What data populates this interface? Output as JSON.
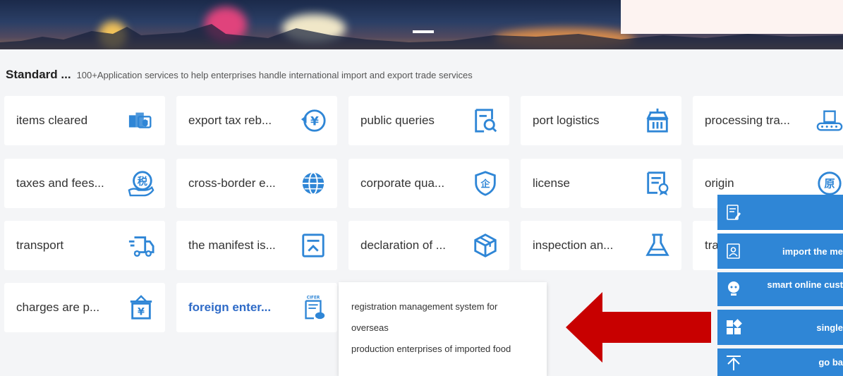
{
  "heading": {
    "title": "Standard ...",
    "subtitle": "100+Application services to help enterprises handle international import and export trade services"
  },
  "cards": [
    {
      "label": "items cleared",
      "icon": "customs-clearance-icon"
    },
    {
      "label": "export tax reb...",
      "icon": "yen-tax-rebate-icon"
    },
    {
      "label": "public queries",
      "icon": "document-search-icon"
    },
    {
      "label": "port logistics",
      "icon": "port-crane-icon"
    },
    {
      "label": "processing tra...",
      "icon": "conveyor-box-icon"
    },
    {
      "label": "taxes and fees...",
      "icon": "tax-hand-icon"
    },
    {
      "label": "cross-border e...",
      "icon": "globe-icon"
    },
    {
      "label": "corporate qua...",
      "icon": "shield-enterprise-icon"
    },
    {
      "label": "license",
      "icon": "certificate-icon"
    },
    {
      "label": "origin",
      "icon": "origin-badge-icon"
    },
    {
      "label": "transport",
      "icon": "truck-icon"
    },
    {
      "label": "the manifest is...",
      "icon": "manifest-upload-icon"
    },
    {
      "label": "declaration of ...",
      "icon": "package-box-icon"
    },
    {
      "label": "inspection an...",
      "icon": "flask-icon"
    },
    {
      "label": "tra",
      "icon": "hidden-icon"
    },
    {
      "label": "charges are p...",
      "icon": "yen-box-icon"
    },
    {
      "label": "foreign enter...",
      "icon": "cifer-document-icon"
    }
  ],
  "icon_glyphs": {
    "tax": "税",
    "enterprise": "企",
    "origin": "原",
    "yen": "¥",
    "cifer": "CIFER"
  },
  "tooltip": {
    "line1": "registration management system for overseas",
    "line2": "production enterprises of imported food"
  },
  "float_panel": [
    {
      "label": "",
      "icon": "edit-document-icon"
    },
    {
      "label": "import the me",
      "icon": "contact-card-icon"
    },
    {
      "label": "smart online cust",
      "icon": "robot-assistant-icon"
    },
    {
      "label": "single",
      "icon": "app-grid-icon"
    },
    {
      "label": "go ba",
      "icon": "back-to-top-icon"
    }
  ],
  "colors": {
    "accent_blue": "#2f86d6",
    "active_text": "#2f6bc7",
    "arrow_red": "#c80000",
    "icon_blue": "#2f86d6"
  }
}
